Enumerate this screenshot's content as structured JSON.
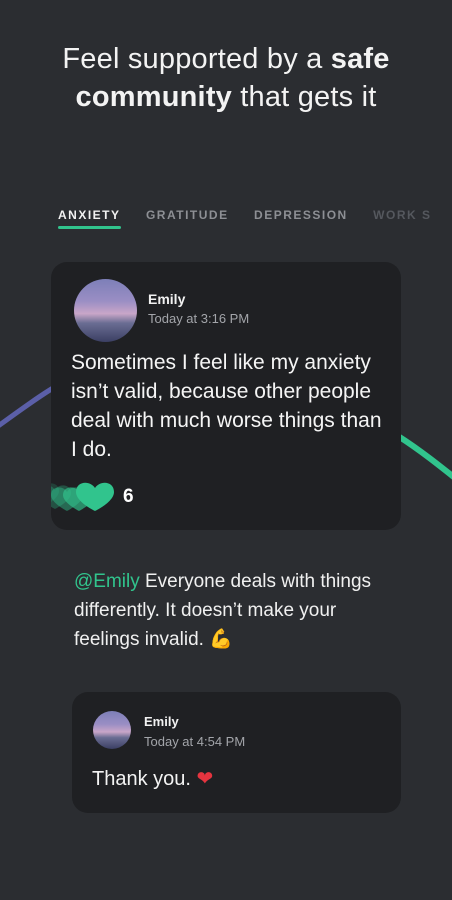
{
  "headline": {
    "part1": "Feel supported by a ",
    "bold1": "safe",
    "bold2": "community",
    "part2": " that gets it"
  },
  "tabs": [
    {
      "label": "ANXIETY",
      "active": true
    },
    {
      "label": "GRATITUDE",
      "active": false
    },
    {
      "label": "DEPRESSION",
      "active": false
    },
    {
      "label": "WORK S",
      "active": false
    }
  ],
  "post": {
    "author": "Emily",
    "timestamp": "Today at 3:16 PM",
    "text": "Sometimes I feel like my anxiety isn’t valid, because other people deal with much worse things than I do.",
    "like_count": "6",
    "like_icon": "heart-icon"
  },
  "reply": {
    "mention": "@Emily",
    "text": " Everyone deals with things differently. It doesn’t make your feelings invalid. ",
    "emoji": "💪"
  },
  "response": {
    "author": "Emily",
    "timestamp": "Today at 4:54 PM",
    "text": "Thank you. ",
    "emoji": "❤"
  },
  "colors": {
    "background": "#2b2d31",
    "card": "#1f2023",
    "accent": "#31c48d",
    "arc_left": "#5b5fa8"
  }
}
